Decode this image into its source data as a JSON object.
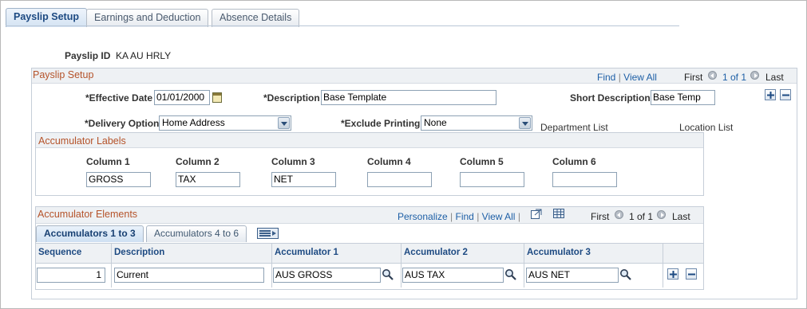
{
  "tabs": [
    {
      "label": "Payslip Setup",
      "active": true
    },
    {
      "label": "Earnings and Deduction",
      "active": false
    },
    {
      "label": "Absence Details",
      "active": false
    }
  ],
  "payslip": {
    "id_label": "Payslip ID",
    "id_value": "KA AU HRLY"
  },
  "setup": {
    "title": "Payslip Setup",
    "nav": {
      "find": "Find",
      "view_all": "View All",
      "first": "First",
      "count": "1 of 1",
      "last": "Last"
    },
    "effective_date": {
      "label": "*Effective Date",
      "value": "01/01/2000"
    },
    "description": {
      "label": "*Description",
      "value": "Base Template"
    },
    "short_description": {
      "label": "Short Description",
      "value": "Base Temp"
    },
    "delivery_option": {
      "label": "*Delivery Option",
      "value": "Home Address"
    },
    "exclude_printing": {
      "label": "*Exclude Printing",
      "value": "None"
    },
    "department_list": "Department List",
    "location_list": "Location List"
  },
  "labels_group": {
    "title": "Accumulator Labels",
    "columns": [
      {
        "label": "Column 1",
        "value": "GROSS"
      },
      {
        "label": "Column 2",
        "value": "TAX"
      },
      {
        "label": "Column 3",
        "value": "NET"
      },
      {
        "label": "Column 4",
        "value": ""
      },
      {
        "label": "Column 5",
        "value": ""
      },
      {
        "label": "Column 6",
        "value": ""
      }
    ]
  },
  "elements": {
    "title": "Accumulator Elements",
    "nav": {
      "personalize": "Personalize",
      "find": "Find",
      "view_all": "View All",
      "first": "First",
      "count": "1 of 1",
      "last": "Last"
    },
    "subtabs": [
      {
        "label": "Accumulators 1 to 3",
        "active": true
      },
      {
        "label": "Accumulators 4 to 6",
        "active": false
      }
    ],
    "headers": [
      "Sequence",
      "Description",
      "Accumulator 1",
      "Accumulator 2",
      "Accumulator 3"
    ],
    "rows": [
      {
        "sequence": "1",
        "description": "Current",
        "acc1": "AUS GROSS",
        "acc2": "AUS TAX",
        "acc3": "AUS NET"
      }
    ]
  }
}
